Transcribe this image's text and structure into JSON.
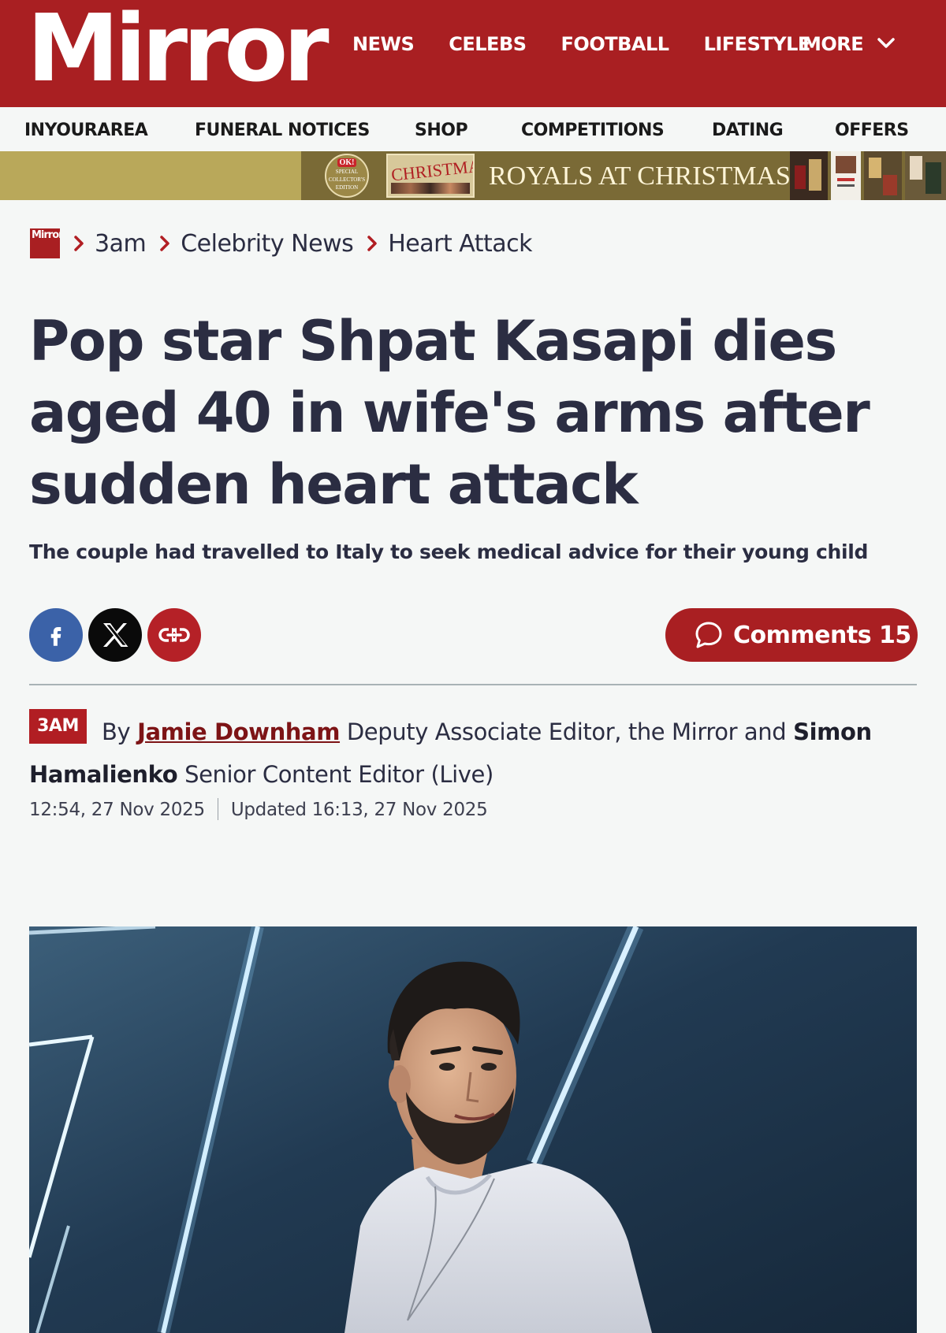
{
  "header": {
    "logo": "Mirror",
    "nav": [
      "NEWS",
      "CELEBS",
      "FOOTBALL",
      "LIFESTYLE"
    ],
    "more_label": "MORE",
    "brand_color": "#a91f22"
  },
  "subnav": [
    "INYOURAREA",
    "FUNERAL NOTICES",
    "SHOP",
    "COMPETITIONS",
    "DATING",
    "OFFERS"
  ],
  "promo": {
    "badge_brand": "OK!",
    "badge_text": "SPECIAL COLLECTOR'S EDITION",
    "magazine_title": "CHRISTMAS",
    "headline": "ROYALS AT CHRISTMAS"
  },
  "breadcrumb": {
    "logo": "Mirror",
    "items": [
      "3am",
      "Celebrity News",
      "Heart Attack"
    ]
  },
  "article": {
    "headline": "Pop star Shpat Kasapi dies aged 40 in wife's arms after sudden heart attack",
    "standfirst": "The couple had travelled to Italy to seek medical advice for their young child",
    "comments_label": "Comments 15",
    "section_tag": "3AM",
    "byline": {
      "by": "By",
      "author1": "Jamie Downham",
      "author1_role": "Deputy Associate Editor, the Mirror and",
      "author2": "Simon Hamalienko",
      "author2_role": "Senior Content Editor (Live)"
    },
    "published": "12:54, 27 Nov 2025",
    "updated": "Updated 16:13, 27 Nov 2025"
  },
  "icons": {
    "facebook": "facebook-icon",
    "x": "x-icon",
    "link": "link-icon",
    "comment": "comment-icon",
    "chevron": "chevron-down-icon"
  }
}
